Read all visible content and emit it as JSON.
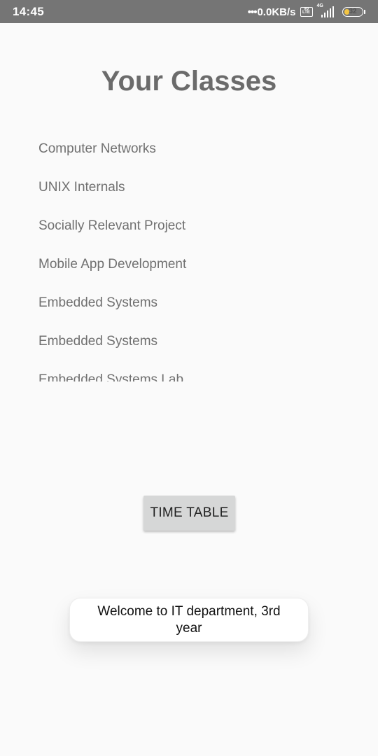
{
  "status_bar": {
    "time": "14:45",
    "net_speed": "0.0KB/s",
    "net_dots": "•••",
    "volte_label": "Vo LTE",
    "signal_label": "4G",
    "battery_level": "32",
    "battery_color": "#f4c542",
    "icons": [
      "volte-icon",
      "signal-icon",
      "battery-icon"
    ]
  },
  "header": {
    "title": "Your Classes"
  },
  "classes": [
    "Computer Networks",
    "UNIX Internals",
    "Socially Relevant Project",
    "Mobile App Development",
    "Embedded Systems",
    "Embedded Systems",
    "Embedded Systems Lab"
  ],
  "actions": {
    "timetable_label": "TIME TABLE"
  },
  "toast": {
    "message": "Welcome to IT department, 3rd year"
  }
}
